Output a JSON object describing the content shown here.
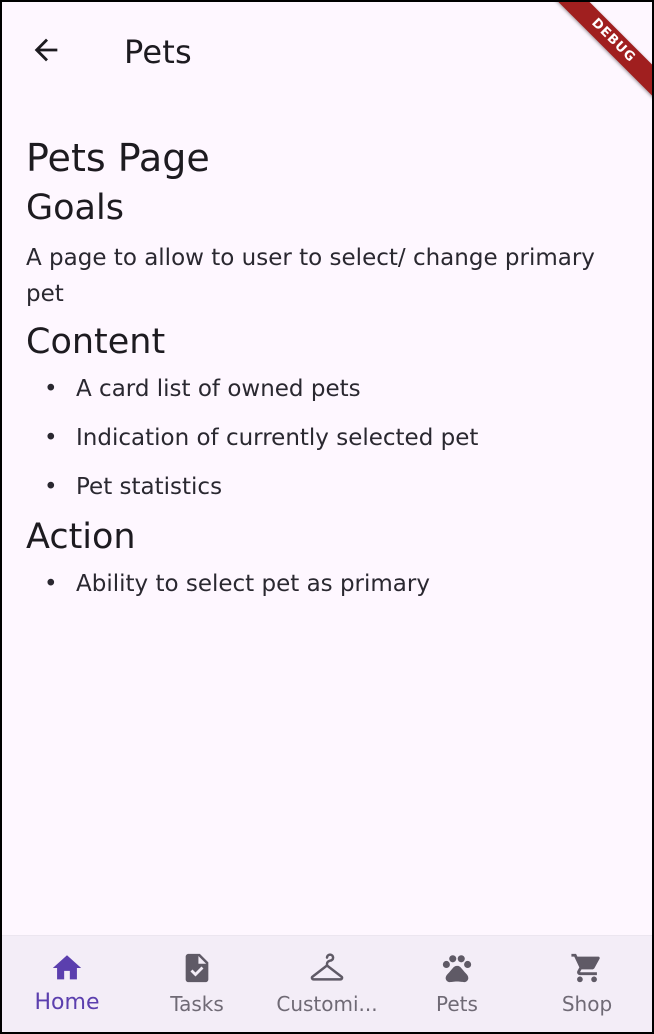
{
  "app_bar": {
    "title": "Pets",
    "back_icon": "arrow-back-icon",
    "debug_label": "DEBUG"
  },
  "page": {
    "title": "Pets Page",
    "goals_heading": "Goals",
    "goals_text": "A page to allow to user to select/ change primary pet",
    "content_heading": "Content",
    "content_items": [
      "A card list of owned pets",
      "Indication of currently selected pet",
      "Pet statistics"
    ],
    "action_heading": "Action",
    "action_items": [
      "Ability to select pet as primary"
    ],
    "bullet": "•"
  },
  "nav": {
    "items": [
      {
        "label": "Home",
        "icon": "home-icon",
        "active": true
      },
      {
        "label": "Tasks",
        "icon": "task-icon",
        "active": false
      },
      {
        "label": "Customi...",
        "icon": "hanger-icon",
        "active": false
      },
      {
        "label": "Pets",
        "icon": "paw-icon",
        "active": false
      },
      {
        "label": "Shop",
        "icon": "cart-icon",
        "active": false
      }
    ]
  },
  "colors": {
    "background": "#fef7ff",
    "nav_background": "#f3edf7",
    "active": "#5b3fae",
    "inactive": "#6f6a75",
    "debug": "#a01f1f"
  }
}
